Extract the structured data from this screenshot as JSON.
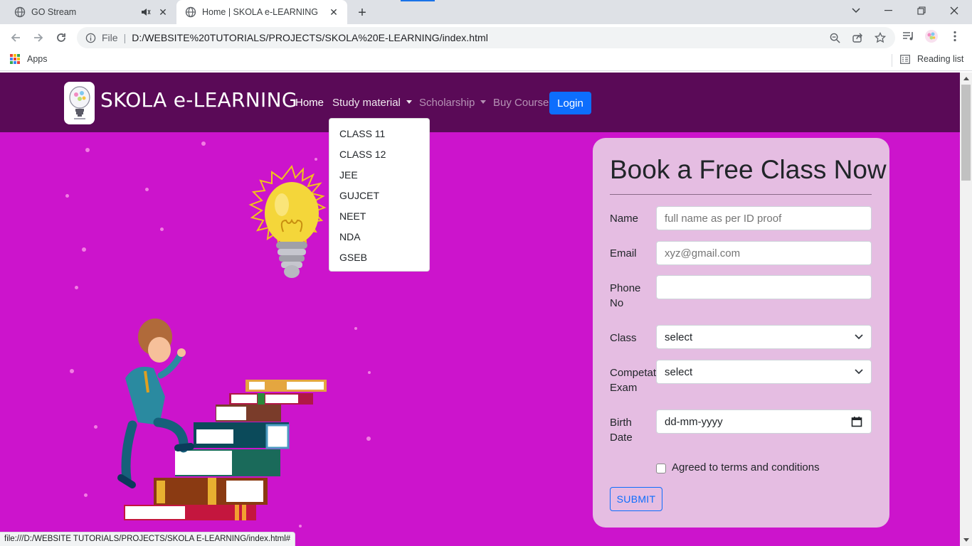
{
  "browser": {
    "tabs": [
      {
        "title": "GO Stream",
        "active": false,
        "audio": true
      },
      {
        "title": "Home | SKOLA e-LEARNING",
        "active": true,
        "audio": false
      }
    ],
    "address_scheme": "File",
    "address_url": "D:/WEBSITE%20TUTORIALS/PROJECTS/SKOLA%20E-LEARNING/index.html",
    "bookmarks": {
      "apps_label": "Apps",
      "reading_list_label": "Reading list"
    },
    "status_url": "file:///D:/WEBSITE TUTORIALS/PROJECTS/SKOLA E-LEARNING/index.html#"
  },
  "site": {
    "brand": "SKOLA e-LEARNING",
    "nav": {
      "home": "Home",
      "study_material": "Study material",
      "scholarship": "Scholarship",
      "buy_course": "Buy Course",
      "login": "Login"
    },
    "study_material_menu": [
      "CLASS 11",
      "CLASS 12",
      "JEE",
      "GUJCET",
      "NEET",
      "NDA",
      "GSEB"
    ],
    "form": {
      "title": "Book a Free Class Now",
      "name_label": "Name",
      "name_placeholder": "full name as per ID proof",
      "email_label": "Email",
      "email_placeholder": "xyz@gmail.com",
      "phone_label": "Phone No",
      "phone_value": "",
      "class_label": "Class",
      "class_value": "select",
      "exam_label": "Competative Exam",
      "exam_value": "select",
      "birth_label": "Birth Date",
      "birth_placeholder": "dd-mm-yyyy",
      "terms_label": "Agreed to terms and conditions",
      "terms_checked": false,
      "submit_label": "SUBMIT"
    }
  },
  "colors": {
    "nav_bg": "#5a0a57",
    "page_bg": "#cc14cc",
    "card_bg": "#e5bde2",
    "primary": "#0d6efd"
  }
}
